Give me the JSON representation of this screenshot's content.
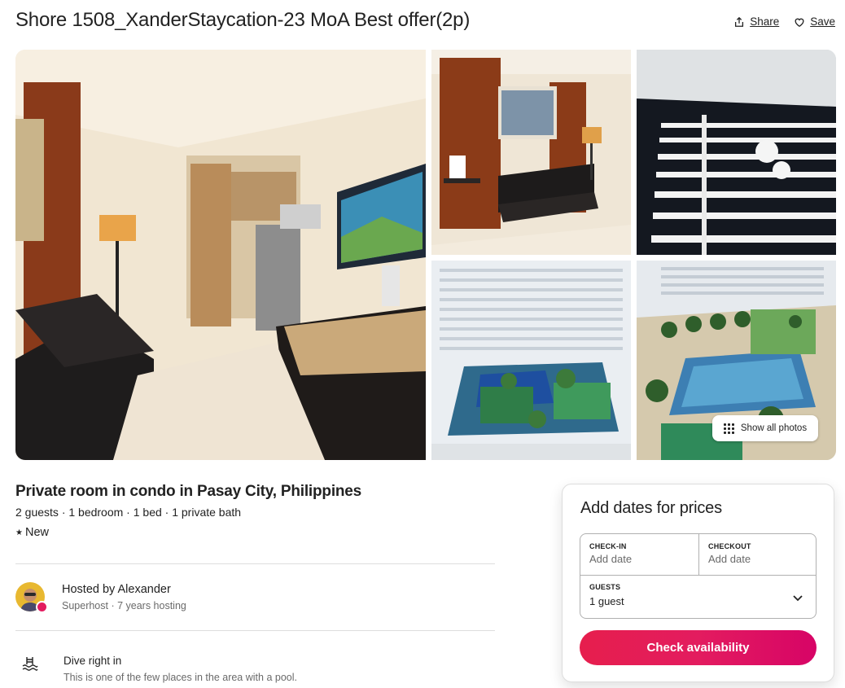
{
  "header": {
    "title": "Shore 1508_XanderStaycation-23 MoA Best offer(2p)",
    "share_label": "Share",
    "save_label": "Save"
  },
  "gallery": {
    "show_all_label": "Show all photos",
    "photos": [
      "living-room-photo",
      "sofa-photo",
      "bed-photo",
      "pool-view-photo",
      "courtyard-view-photo"
    ]
  },
  "listing": {
    "title": "Private room in condo in Pasay City, Philippines",
    "details": "2 guests · 1 bedroom · 1 bed · 1 private bath",
    "badge": "New"
  },
  "host": {
    "name": "Hosted by Alexander",
    "meta": "Superhost · 7 years hosting"
  },
  "feature": {
    "title": "Dive right in",
    "description": "This is one of the few places in the area with a pool."
  },
  "booking": {
    "title": "Add dates for prices",
    "checkin_label": "CHECK-IN",
    "checkin_value": "Add date",
    "checkout_label": "CHECKOUT",
    "checkout_value": "Add date",
    "guests_label": "GUESTS",
    "guests_value": "1 guest",
    "cta_label": "Check availability"
  },
  "colors": {
    "accent": "#e31c5f",
    "text": "#222222",
    "muted": "#6a6a6a",
    "border": "#dddddd"
  }
}
